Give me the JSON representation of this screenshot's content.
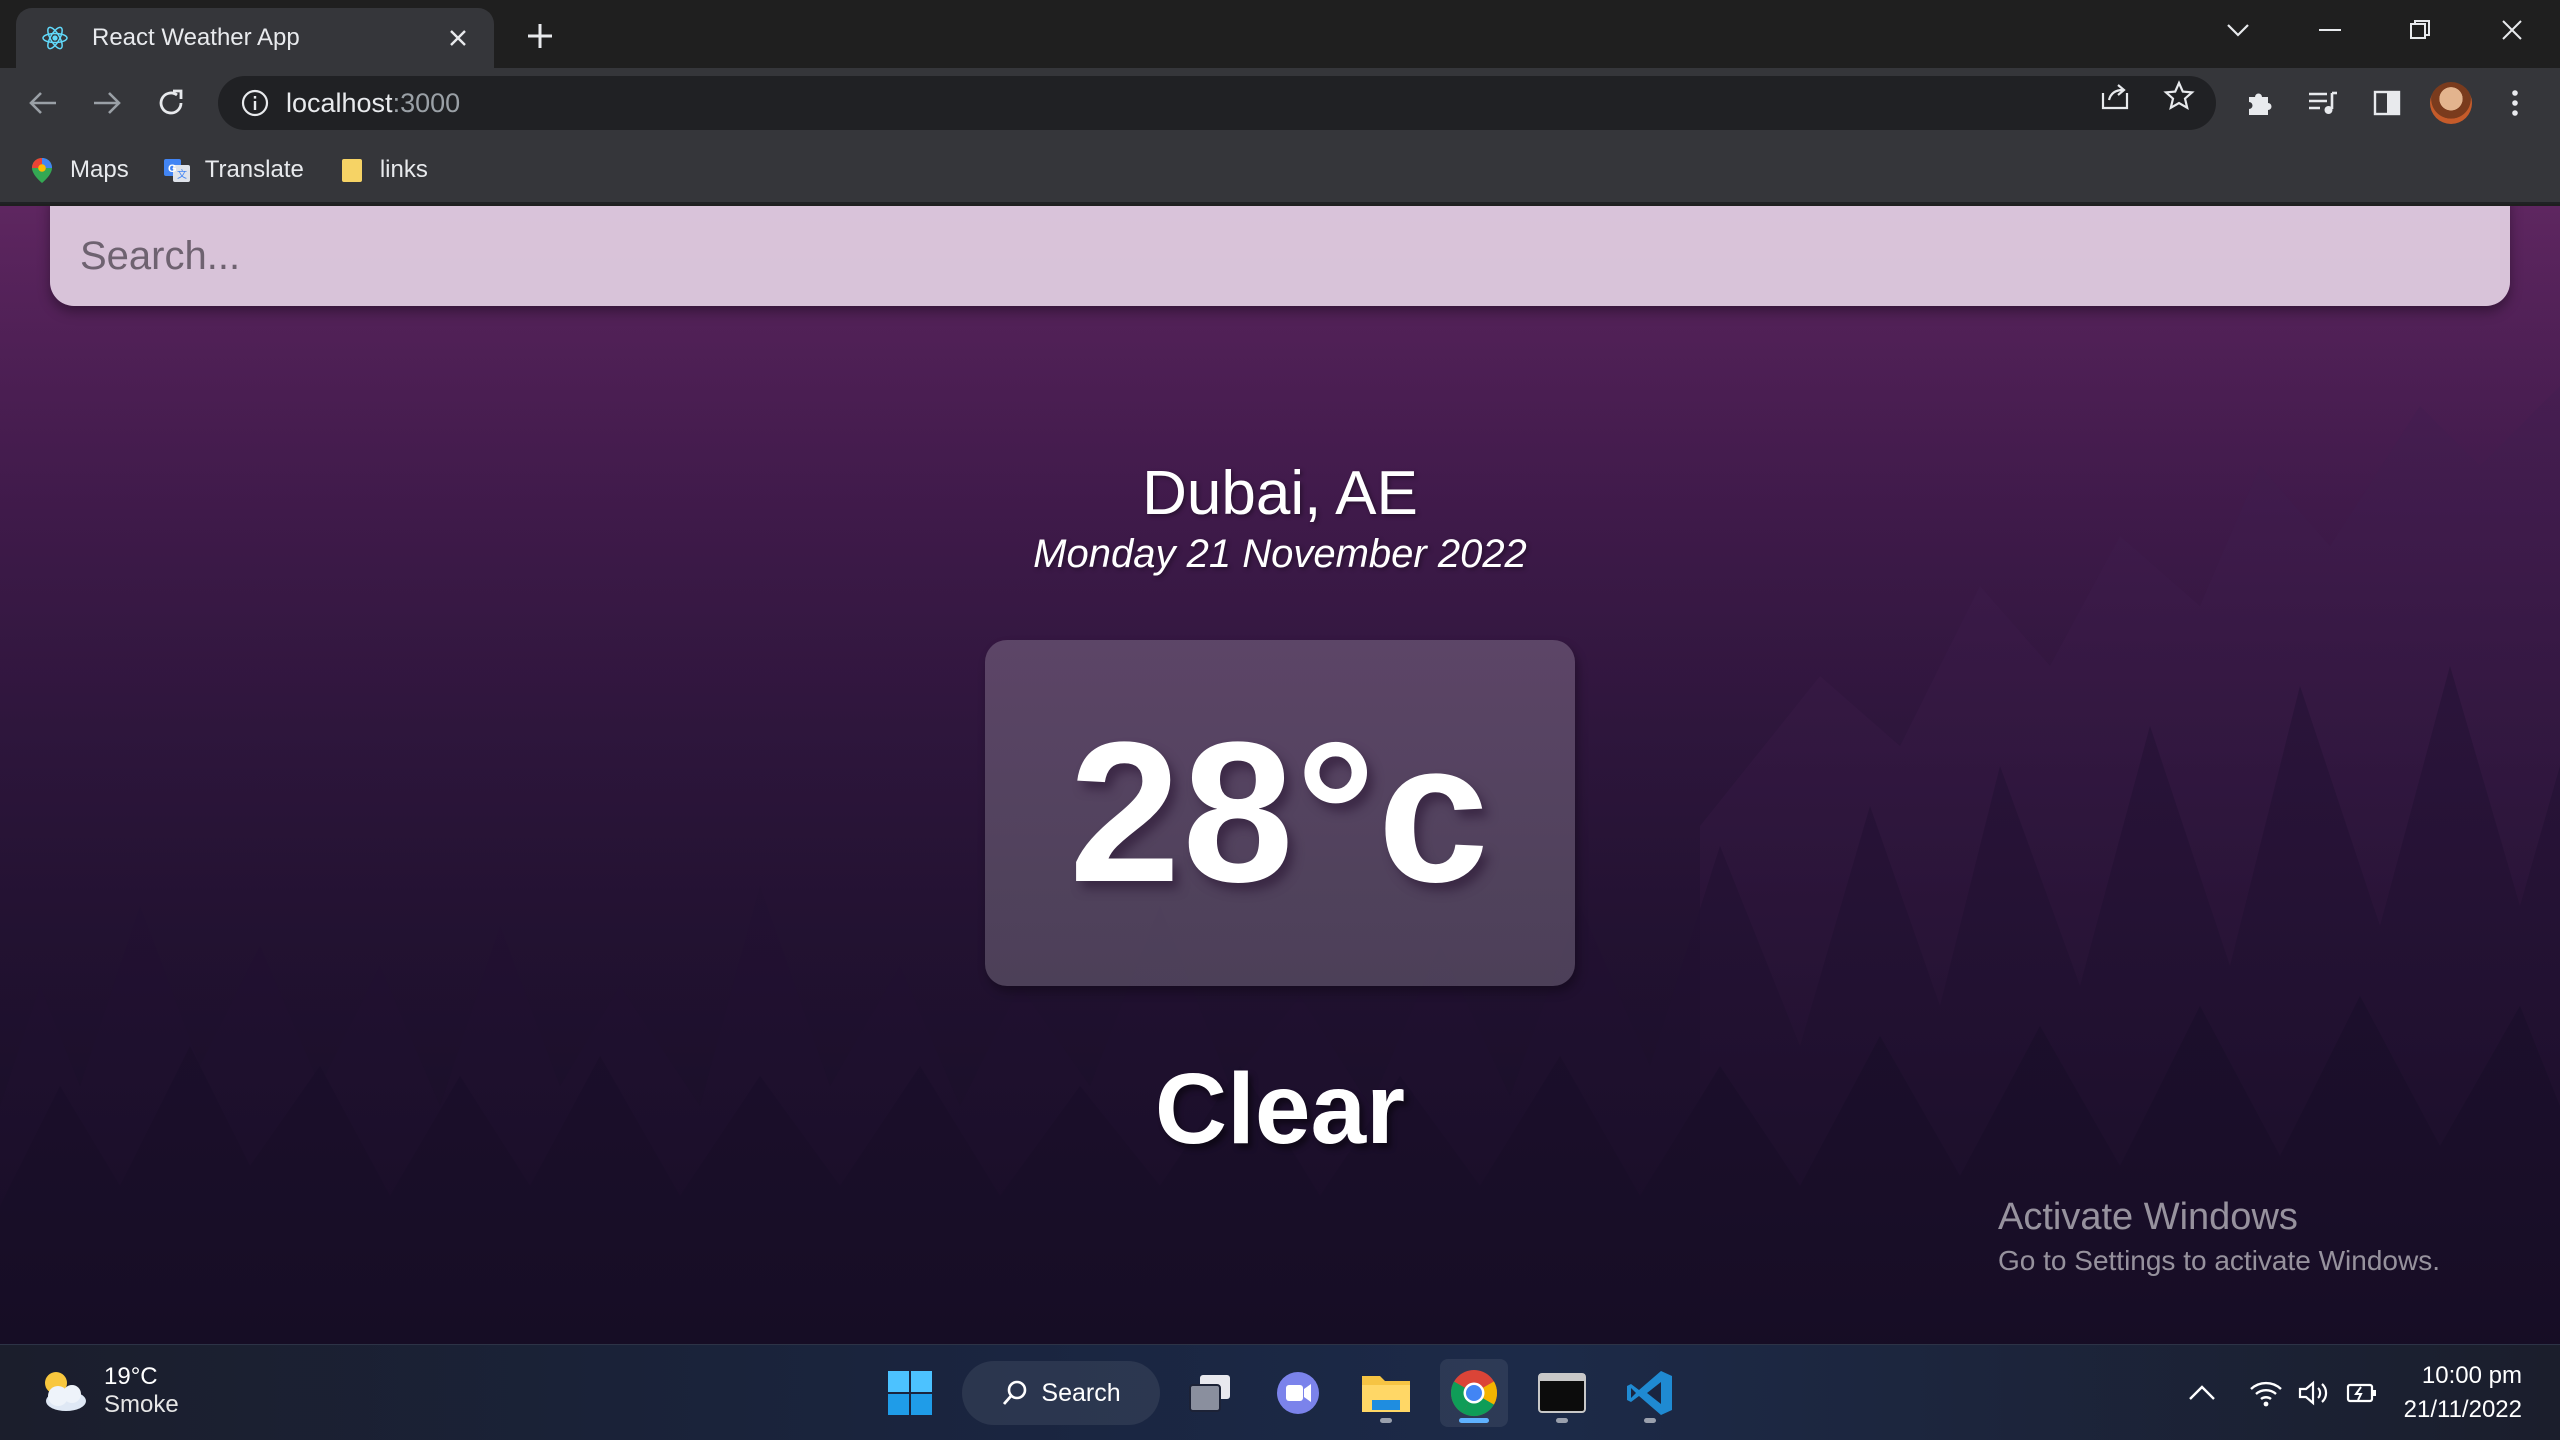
{
  "browser": {
    "tab_title": "React Weather App",
    "url_host": "localhost",
    "url_port": ":3000",
    "bookmarks": [
      {
        "label": "Maps"
      },
      {
        "label": "Translate"
      },
      {
        "label": "links"
      }
    ]
  },
  "app": {
    "search_placeholder": "Search...",
    "location": "Dubai, AE",
    "date": "Monday 21 November 2022",
    "temperature": "28°c",
    "weather": "Clear"
  },
  "watermark": {
    "title": "Activate Windows",
    "subtitle": "Go to Settings to activate Windows."
  },
  "taskbar": {
    "weather_temp": "19°C",
    "weather_desc": "Smoke",
    "search_label": "Search",
    "time": "10:00 pm",
    "date": "21/11/2022"
  },
  "colors": {
    "accent": "#5fb2ff",
    "page_top": "#5e2660",
    "page_bottom": "#1c1230"
  }
}
